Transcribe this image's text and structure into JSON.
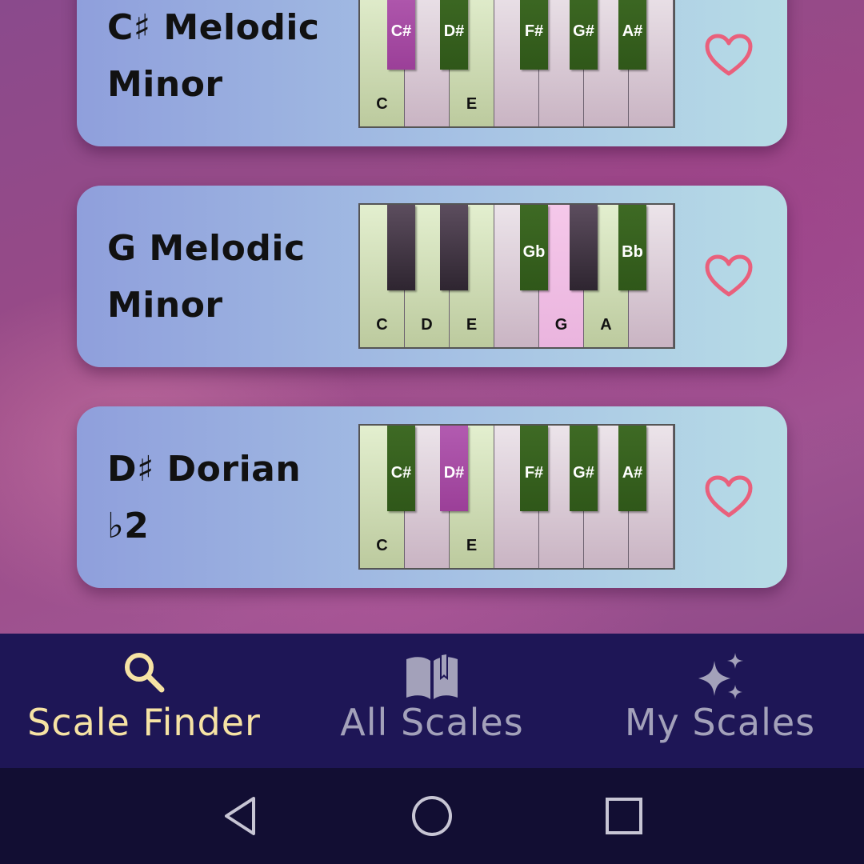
{
  "colors": {
    "heart": "#e9607c",
    "nav_active": "#f6e3a4",
    "nav_inactive": "#a3a1ba",
    "nav_background": "#1e1656",
    "scale_white_key": "#c9d8ac",
    "scale_black_key": "#2f5719",
    "root_key": "#b04ca6"
  },
  "cards": [
    {
      "title_lines": [
        "C♯ Melodic",
        "Minor"
      ],
      "favorite_icon": "heart-outline-icon",
      "white_keys": [
        {
          "label": "C",
          "state": "in"
        },
        {
          "label": "",
          "state": "out"
        },
        {
          "label": "E",
          "state": "in"
        },
        {
          "label": "",
          "state": "out"
        },
        {
          "label": "",
          "state": "out"
        },
        {
          "label": "",
          "state": "out"
        },
        {
          "label": "",
          "state": "out"
        }
      ],
      "black_keys": [
        {
          "label": "C#",
          "state": "root"
        },
        {
          "label": "D#",
          "state": "in"
        },
        {
          "label": "F#",
          "state": "in"
        },
        {
          "label": "G#",
          "state": "in"
        },
        {
          "label": "A#",
          "state": "in"
        }
      ]
    },
    {
      "title_lines": [
        "G Melodic",
        "Minor"
      ],
      "favorite_icon": "heart-outline-icon",
      "white_keys": [
        {
          "label": "C",
          "state": "in"
        },
        {
          "label": "D",
          "state": "in"
        },
        {
          "label": "E",
          "state": "in"
        },
        {
          "label": "",
          "state": "out"
        },
        {
          "label": "G",
          "state": "root"
        },
        {
          "label": "A",
          "state": "in"
        },
        {
          "label": "",
          "state": "out"
        }
      ],
      "black_keys": [
        {
          "label": "",
          "state": "out"
        },
        {
          "label": "",
          "state": "out"
        },
        {
          "label": "Gb",
          "state": "in"
        },
        {
          "label": "",
          "state": "out"
        },
        {
          "label": "Bb",
          "state": "in"
        }
      ]
    },
    {
      "title_lines": [
        "D♯ Dorian ♭2"
      ],
      "favorite_icon": "heart-outline-icon",
      "white_keys": [
        {
          "label": "C",
          "state": "in"
        },
        {
          "label": "",
          "state": "out"
        },
        {
          "label": "E",
          "state": "in"
        },
        {
          "label": "",
          "state": "out"
        },
        {
          "label": "",
          "state": "out"
        },
        {
          "label": "",
          "state": "out"
        },
        {
          "label": "",
          "state": "out"
        }
      ],
      "black_keys": [
        {
          "label": "C#",
          "state": "in"
        },
        {
          "label": "D#",
          "state": "root"
        },
        {
          "label": "F#",
          "state": "in"
        },
        {
          "label": "G#",
          "state": "in"
        },
        {
          "label": "A#",
          "state": "in"
        }
      ]
    }
  ],
  "bottom_nav": {
    "items": [
      {
        "label": "Scale Finder",
        "icon": "search-icon",
        "active": true
      },
      {
        "label": "All Scales",
        "icon": "book-icon",
        "active": false
      },
      {
        "label": "My Scales",
        "icon": "sparkles-icon",
        "active": false
      }
    ]
  },
  "system_nav": {
    "buttons": [
      "back-icon",
      "home-icon",
      "recents-icon"
    ]
  }
}
